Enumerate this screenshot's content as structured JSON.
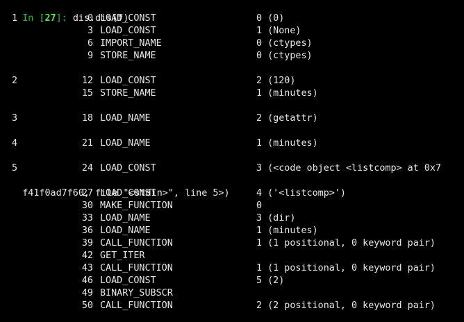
{
  "terminal": {
    "prompt_in": "In [",
    "prompt_num": "27",
    "prompt_close": "]: ",
    "command": "dis.dis(f)",
    "colors": {
      "background": "#000000",
      "text": "#e8e8e8",
      "prompt": "#35b531",
      "prompt_number": "#5fe05a"
    },
    "rows": [
      {
        "lineno": "1",
        "offset": "0",
        "op": "LOAD_CONST",
        "arg": "0 (0)"
      },
      {
        "lineno": "",
        "offset": "3",
        "op": "LOAD_CONST",
        "arg": "1 (None)"
      },
      {
        "lineno": "",
        "offset": "6",
        "op": "IMPORT_NAME",
        "arg": "0 (ctypes)"
      },
      {
        "lineno": "",
        "offset": "9",
        "op": "STORE_NAME",
        "arg": "0 (ctypes)"
      },
      {
        "lineno": "2",
        "offset": "12",
        "op": "LOAD_CONST",
        "arg": "2 (120)"
      },
      {
        "lineno": "",
        "offset": "15",
        "op": "STORE_NAME",
        "arg": "1 (minutes)"
      },
      {
        "lineno": "3",
        "offset": "18",
        "op": "LOAD_NAME",
        "arg": "2 (getattr)"
      },
      {
        "lineno": "4",
        "offset": "21",
        "op": "LOAD_NAME",
        "arg": "1 (minutes)"
      },
      {
        "lineno": "5",
        "offset": "24",
        "op": "LOAD_CONST",
        "arg": "3 (<code object <listcomp> at 0x7"
      },
      {
        "wrapped": "f41f0ad7f60, file \"<stdin>\", line 5>)"
      },
      {
        "lineno": "",
        "offset": "27",
        "op": "LOAD_CONST",
        "arg": "4 ('<listcomp>')"
      },
      {
        "lineno": "",
        "offset": "30",
        "op": "MAKE_FUNCTION",
        "arg": "0"
      },
      {
        "lineno": "",
        "offset": "33",
        "op": "LOAD_NAME",
        "arg": "3 (dir)"
      },
      {
        "lineno": "",
        "offset": "36",
        "op": "LOAD_NAME",
        "arg": "1 (minutes)"
      },
      {
        "lineno": "",
        "offset": "39",
        "op": "CALL_FUNCTION",
        "arg": "1 (1 positional, 0 keyword pair)"
      },
      {
        "lineno": "",
        "offset": "42",
        "op": "GET_ITER",
        "arg": ""
      },
      {
        "lineno": "",
        "offset": "43",
        "op": "CALL_FUNCTION",
        "arg": "1 (1 positional, 0 keyword pair)"
      },
      {
        "lineno": "",
        "offset": "46",
        "op": "LOAD_CONST",
        "arg": "5 (2)"
      },
      {
        "lineno": "",
        "offset": "49",
        "op": "BINARY_SUBSCR",
        "arg": ""
      },
      {
        "lineno": "",
        "offset": "50",
        "op": "CALL_FUNCTION",
        "arg": "2 (2 positional, 0 keyword pair)"
      }
    ]
  }
}
